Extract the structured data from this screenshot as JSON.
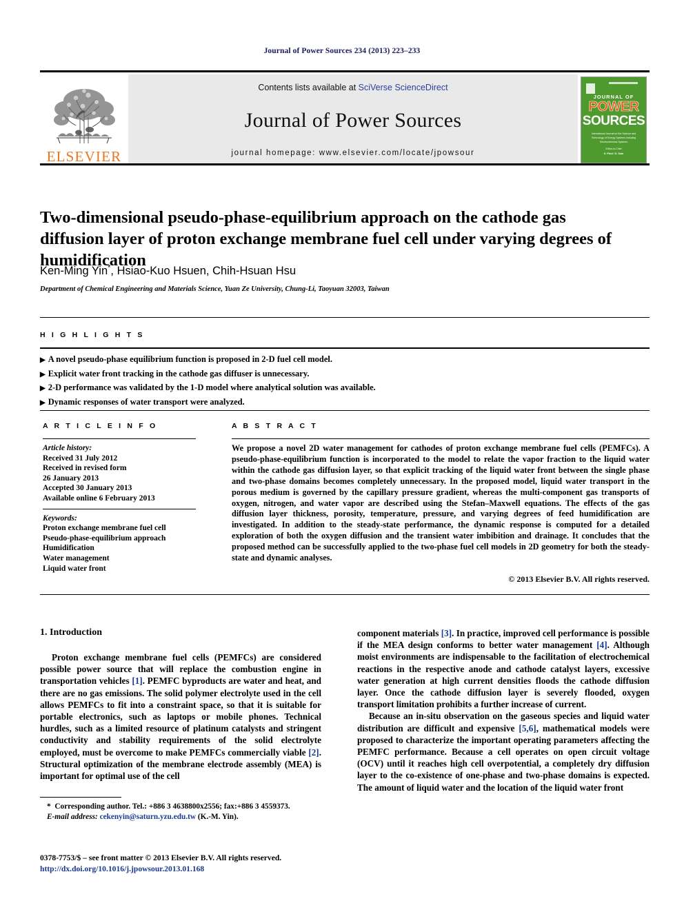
{
  "running_head": "Journal of Power Sources 234 (2013) 223–233",
  "masthead": {
    "publisher_name": "ELSEVIER",
    "contents_prefix": "Contents lists available at ",
    "contents_link": "SciVerse ScienceDirect",
    "journal_title": "Journal of Power Sources",
    "homepage": "journal homepage: www.elsevier.com/locate/jpowsour",
    "cover": {
      "line_journal_of": "JOURNAL OF",
      "line_power": "POWER",
      "line_sources": "SOURCES",
      "subtitle": "International Journal on the Science and Technology of Energy Systems including Electrochemical Systems",
      "footer_small": "Editor-in-Chief",
      "footer_name": "S. Pikul / K. Sato",
      "bg_color": "#4e9a2f",
      "accent_color": "#E05A10"
    }
  },
  "article": {
    "title": "Two-dimensional pseudo-phase-equilibrium approach on the cathode gas diffusion layer of proton exchange membrane fuel cell under varying degrees of humidification",
    "authors": "Ken-Ming Yin, Hsiao-Kuo Hsuen, Chih-Hsuan Hsu",
    "corresponding_marker": "*",
    "affiliation": "Department of Chemical Engineering and Materials Science, Yuan Ze University, Chung-Li, Taoyuan 32003, Taiwan"
  },
  "highlights": {
    "heading": "H I G H L I G H T S",
    "bullet_glyph": "▶",
    "items": [
      "A novel pseudo-phase equilibrium function is proposed in 2-D fuel cell model.",
      "Explicit water front tracking in the cathode gas diffuser is unnecessary.",
      "2-D performance was validated by the 1-D model where analytical solution was available.",
      "Dynamic responses of water transport were analyzed."
    ]
  },
  "article_info": {
    "heading": "A R T I C L E   I N F O",
    "history_label": "Article history:",
    "history_lines": [
      "Received 31 July 2012",
      "Received in revised form",
      "26 January 2013",
      "Accepted 30 January 2013",
      "Available online 6 February 2013"
    ],
    "keywords_label": "Keywords:",
    "keywords": [
      "Proton exchange membrane fuel cell",
      "Pseudo-phase-equilibrium approach",
      "Humidification",
      "Water management",
      "Liquid water front"
    ]
  },
  "abstract": {
    "heading": "A B S T R A C T",
    "text": "We propose a novel 2D water management for cathodes of proton exchange membrane fuel cells (PEMFCs). A pseudo-phase-equilibrium function is incorporated to the model to relate the vapor fraction to the liquid water within the cathode gas diffusion layer, so that explicit tracking of the liquid water front between the single phase and two-phase domains becomes completely unnecessary. In the proposed model, liquid water transport in the porous medium is governed by the capillary pressure gradient, whereas the multi-component gas transports of oxygen, nitrogen, and water vapor are described using the Stefan–Maxwell equations. The effects of the gas diffusion layer thickness, porosity, temperature, pressure, and varying degrees of feed humidification are investigated. In addition to the steady-state performance, the dynamic response is computed for a detailed exploration of both the oxygen diffusion and the transient water imbibition and drainage. It concludes that the proposed method can be successfully applied to the two-phase fuel cell models in 2D geometry for both the steady-state and dynamic analyses.",
    "copyright": "© 2013 Elsevier B.V. All rights reserved."
  },
  "body": {
    "section_number_title": "1.  Introduction",
    "left_paragraph_1_a": "Proton exchange membrane fuel cells (PEMFCs) are considered possible power source that will replace the combustion engine in transportation vehicles ",
    "left_ref_1": "[1]",
    "left_paragraph_1_b": ". PEMFC byproducts are water and heat, and there are no gas emissions. The solid polymer electrolyte used in the cell allows PEMFCs to fit into a constraint space, so that it is suitable for portable electronics, such as laptops or mobile phones. Technical hurdles, such as a limited resource of platinum catalysts and stringent conductivity and stability requirements of the solid electrolyte employed, must be overcome to make PEMFCs commercially viable ",
    "left_ref_2": "[2]",
    "left_paragraph_1_c": ". Structural optimization of the membrane electrode assembly (MEA) is important for optimal use of the cell",
    "right_paragraph_1_a": "component materials ",
    "right_ref_3": "[3]",
    "right_paragraph_1_b": ". In practice, improved cell performance is possible if the MEA design conforms to better water management ",
    "right_ref_4": "[4]",
    "right_paragraph_1_c": ". Although moist environments are indispensable to the facilitation of electrochemical reactions in the respective anode and cathode catalyst layers, excessive water generation at high current densities floods the cathode diffusion layer. Once the cathode diffusion layer is severely flooded, oxygen transport limitation prohibits a further increase of current.",
    "right_paragraph_2_a": "Because an in-situ observation on the gaseous species and liquid water distribution are difficult and expensive ",
    "right_ref_56": "[5,6]",
    "right_paragraph_2_b": ", mathematical models were proposed to characterize the important operating parameters affecting the PEMFC performance. Because a cell operates on open circuit voltage (OCV) until it reaches high cell overpotential, a completely dry diffusion layer to the co-existence of one-phase and two-phase domains is expected. The amount of liquid water and the location of the liquid water front"
  },
  "footnote": {
    "corresponding_marker": "*",
    "corresponding_text": "Corresponding author. Tel.: +886 3 4638800x2556; fax:+886 3 4559373.",
    "email_label": "E-mail address:",
    "email": "cekenyin@saturn.yzu.edu.tw",
    "email_suffix": "(K.-M. Yin)."
  },
  "footer": {
    "issn_line": "0378-7753/$ – see front matter © 2013 Elsevier B.V. All rights reserved.",
    "doi": "http://dx.doi.org/10.1016/j.jpowsour.2013.01.168"
  }
}
